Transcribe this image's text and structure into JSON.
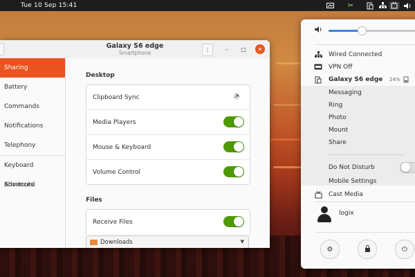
{
  "topbar": {
    "clock": "Tue 10 Sep  15:41",
    "icons": [
      "screen-icon",
      "gconnect-icon",
      "phone-icon",
      "network-icon",
      "battery-icon",
      "volume-icon"
    ]
  },
  "window": {
    "title": "Galaxy S6 edge",
    "subtitle": "Smartphone",
    "menu_label": "⋮",
    "minimize_label": "–",
    "maximize_label": "□",
    "close_label": "✕",
    "sidebar": [
      {
        "label": "Sharing",
        "selected": true
      },
      {
        "label": "Battery"
      },
      {
        "label": "Commands"
      },
      {
        "label": "Notifications"
      },
      {
        "label": "Telephony"
      },
      {
        "label": "Keyboard Shortcuts"
      },
      {
        "label": "Advanced"
      }
    ],
    "desktop": {
      "heading": "Desktop",
      "rows": [
        {
          "label": "Clipboard Sync",
          "control": "external-link-icon"
        },
        {
          "label": "Media Players",
          "control": "switch",
          "on": true
        },
        {
          "label": "Mouse & Keyboard",
          "control": "switch",
          "on": true
        },
        {
          "label": "Volume Control",
          "control": "switch",
          "on": true
        }
      ]
    },
    "files": {
      "heading": "Files",
      "receive_label": "Receive Files",
      "receive_on": true,
      "folder_value": "Downloads"
    },
    "accent_color": "#e95420",
    "switch_color": "#4e9a06"
  },
  "system_menu": {
    "volume_level": 0.37,
    "wired": "Wired Connected",
    "vpn": "VPN Off",
    "device": "Galaxy S6 edge",
    "battery": "24%",
    "submenu": [
      "Messaging",
      "Ring",
      "Photo",
      "Mount",
      "Share"
    ],
    "dnd_label": "Do Not Disturb",
    "dnd_on": false,
    "mobile_settings": "Mobile Settings",
    "cast": "Cast Media",
    "user": "logix",
    "buttons": [
      "settings-icon",
      "lock-icon",
      "power-icon"
    ]
  }
}
